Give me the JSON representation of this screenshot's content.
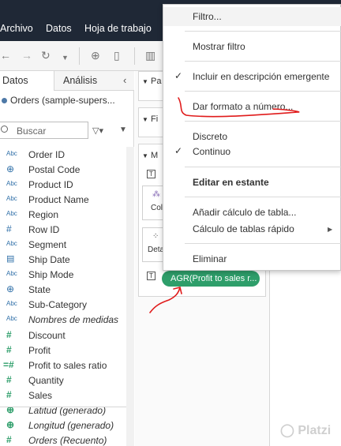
{
  "menubar": {
    "items": [
      "Archivo",
      "Datos",
      "Hoja de trabajo"
    ]
  },
  "data_pane": {
    "tabs": [
      "Datos",
      "Análisis"
    ],
    "datasource": "Orders (sample-supers...",
    "search_placeholder": "Buscar",
    "dimensions": [
      {
        "icon": "Abc",
        "label": "Order ID",
        "italic": false
      },
      {
        "icon": "globe",
        "label": "Postal Code",
        "italic": false
      },
      {
        "icon": "Abc",
        "label": "Product ID",
        "italic": false
      },
      {
        "icon": "Abc",
        "label": "Product Name",
        "italic": false
      },
      {
        "icon": "Abc",
        "label": "Region",
        "italic": false
      },
      {
        "icon": "#",
        "label": "Row ID",
        "italic": false
      },
      {
        "icon": "Abc",
        "label": "Segment",
        "italic": false
      },
      {
        "icon": "calendar",
        "label": "Ship Date",
        "italic": false
      },
      {
        "icon": "Abc",
        "label": "Ship Mode",
        "italic": false
      },
      {
        "icon": "globe",
        "label": "State",
        "italic": false
      },
      {
        "icon": "Abc",
        "label": "Sub-Category",
        "italic": false
      },
      {
        "icon": "Abc",
        "label": "Nombres de medidas",
        "italic": true
      }
    ],
    "measures": [
      {
        "icon": "#",
        "label": "Discount",
        "italic": false
      },
      {
        "icon": "#",
        "label": "Profit",
        "italic": false
      },
      {
        "icon": "=#",
        "label": "Profit to sales ratio",
        "italic": false
      },
      {
        "icon": "#",
        "label": "Quantity",
        "italic": false
      },
      {
        "icon": "#",
        "label": "Sales",
        "italic": false
      },
      {
        "icon": "globe",
        "label": "Latitud (generado)",
        "italic": true
      },
      {
        "icon": "globe",
        "label": "Longitud (generado)",
        "italic": true
      },
      {
        "icon": "#",
        "label": "Orders (Recuento)",
        "italic": true
      }
    ]
  },
  "cards": {
    "pages_label": "Pa",
    "filters_label": "Fi",
    "marks_label": "M",
    "color_label": "Col",
    "detail_label": "Deta",
    "pill_label": "AGR(Profit to sales r..."
  },
  "context_menu": {
    "items": {
      "filtro": "Filtro...",
      "mostrar_filtro": "Mostrar filtro",
      "incluir": "Incluir en descripción emergente",
      "dar_formato": "Dar formato a número...",
      "discreto": "Discreto",
      "continuo": "Continuo",
      "editar": "Editar en estante",
      "anadir_calculo": "Añadir cálculo de tabla...",
      "calculo_rapido": "Cálculo de tablas rápido",
      "eliminar": "Eliminar"
    },
    "checked": [
      "incluir",
      "continuo"
    ]
  },
  "watermark": "Platzi",
  "colors": {
    "menubar": "#1f2836",
    "measure_green": "#2e9e6a",
    "dimension_blue": "#2f6fa8",
    "annotation_red": "#e01b1b"
  }
}
